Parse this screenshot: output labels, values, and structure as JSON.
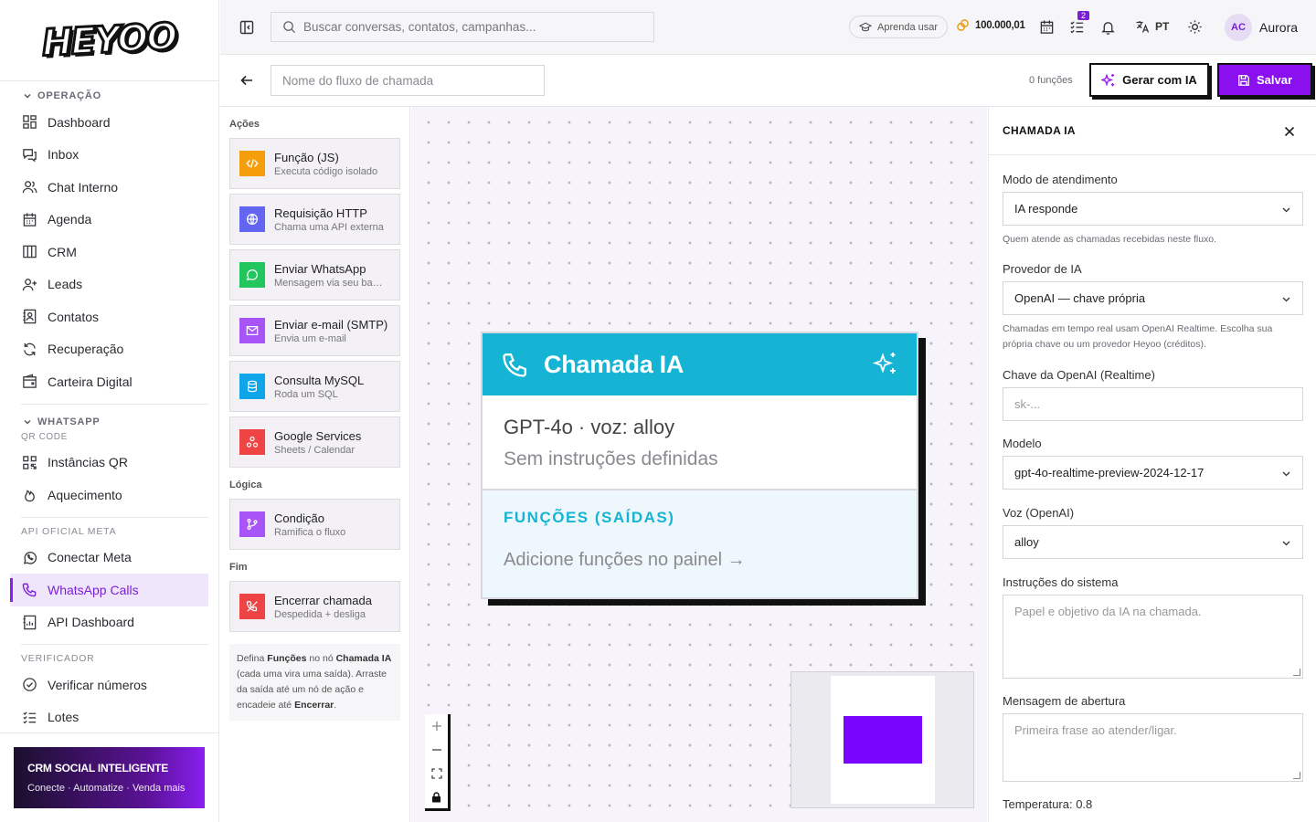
{
  "brand": {
    "logo_text": "HEYOO"
  },
  "sidebar": {
    "sections": {
      "operacao": "OPERAÇÃO",
      "whatsapp": "WHATSAPP",
      "qr_code": "QR CODE",
      "api_meta": "API OFICIAL META",
      "verificador": "VERIFICADOR"
    },
    "items": {
      "dashboard": "Dashboard",
      "inbox": "Inbox",
      "chat_interno": "Chat Interno",
      "agenda": "Agenda",
      "crm": "CRM",
      "leads": "Leads",
      "contatos": "Contatos",
      "recuperacao": "Recuperação",
      "carteira": "Carteira Digital",
      "instancias": "Instâncias QR",
      "aquecimento": "Aquecimento",
      "conectar_meta": "Conectar Meta",
      "whatsapp_calls": "WhatsApp Calls",
      "api_dashboard": "API Dashboard",
      "verificar": "Verificar números",
      "lotes": "Lotes"
    },
    "promo": {
      "title": "CRM SOCIAL INTELIGENTE",
      "subtitle": "Conecte · Automatize · Venda mais"
    }
  },
  "topbar": {
    "search_placeholder": "Buscar conversas, contatos, campanhas...",
    "learn_label": "Aprenda usar",
    "credits": "100.000,01",
    "tasks_badge": "2",
    "language": "PT",
    "avatar_initials": "AC",
    "user_name": "Aurora"
  },
  "flow": {
    "name_placeholder": "Nome do fluxo de chamada",
    "functions_count": "0 funções",
    "generate_label": "Gerar com IA",
    "save_label": "Salvar"
  },
  "palette": {
    "groups": {
      "acoes": "Ações",
      "logica": "Lógica",
      "fim": "Fim"
    },
    "items": [
      {
        "title": "Função (JS)",
        "desc": "Executa código isolado",
        "color": "#f59e0b",
        "icon": "code-icon"
      },
      {
        "title": "Requisição HTTP",
        "desc": "Chama uma API externa",
        "color": "#6366f1",
        "icon": "globe-icon"
      },
      {
        "title": "Enviar WhatsApp",
        "desc": "Mensagem via seu back...",
        "color": "#22c55e",
        "icon": "chat-icon"
      },
      {
        "title": "Enviar e-mail (SMTP)",
        "desc": "Envia um e-mail",
        "color": "#a855f7",
        "icon": "mail-icon"
      },
      {
        "title": "Consulta MySQL",
        "desc": "Roda um SQL",
        "color": "#0ea5e9",
        "icon": "database-icon"
      },
      {
        "title": "Google Services",
        "desc": "Sheets / Calendar",
        "color": "#ef4444",
        "icon": "google-icon"
      },
      {
        "title": "Condição",
        "desc": "Ramifica o fluxo",
        "color": "#a855f7",
        "icon": "branch-icon"
      },
      {
        "title": "Encerrar chamada",
        "desc": "Despedida + desliga",
        "color": "#ef4444",
        "icon": "hangup-icon"
      }
    ],
    "note": {
      "p1": "Defina ",
      "b1": "Funções",
      "p2": " no nó ",
      "b2": "Chamada IA",
      "p3": " (cada uma vira uma saída). Arraste da saída até um nó de ação e encadeie até ",
      "b3": "Encerrar",
      "p4": "."
    }
  },
  "node": {
    "title": "Chamada IA",
    "model_line": "GPT-4o · voz: alloy",
    "instructions": "Sem instruções definidas",
    "functions_title": "FUNÇÕES (SAÍDAS)",
    "functions_hint": "Adicione funções no painel →",
    "header_color": "#16b4d4"
  },
  "canvas_controls": {
    "zoom_in": "+",
    "zoom_out": "—"
  },
  "props": {
    "title": "CHAMADA IA",
    "mode_label": "Modo de atendimento",
    "mode_value": "IA responde",
    "mode_help": "Quem atende as chamadas recebidas neste fluxo.",
    "provider_label": "Provedor de IA",
    "provider_value": "OpenAI — chave própria",
    "provider_help": "Chamadas em tempo real usam OpenAI Realtime. Escolha sua própria chave ou um provedor Heyoo (créditos).",
    "key_label": "Chave da OpenAI (Realtime)",
    "key_placeholder": "sk-...",
    "model_label": "Modelo",
    "model_value": "gpt-4o-realtime-preview-2024-12-17",
    "voice_label": "Voz (OpenAI)",
    "voice_value": "alloy",
    "instructions_label": "Instruções do sistema",
    "instructions_placeholder": "Papel e objetivo da IA na chamada.",
    "opening_label": "Mensagem de abertura",
    "opening_placeholder": "Primeira frase ao atender/ligar.",
    "temperature_label": "Temperatura: 0.8"
  },
  "colors": {
    "accent": "#8a10f0",
    "node_header": "#16b4d4",
    "active_bg": "#efe6fb"
  }
}
